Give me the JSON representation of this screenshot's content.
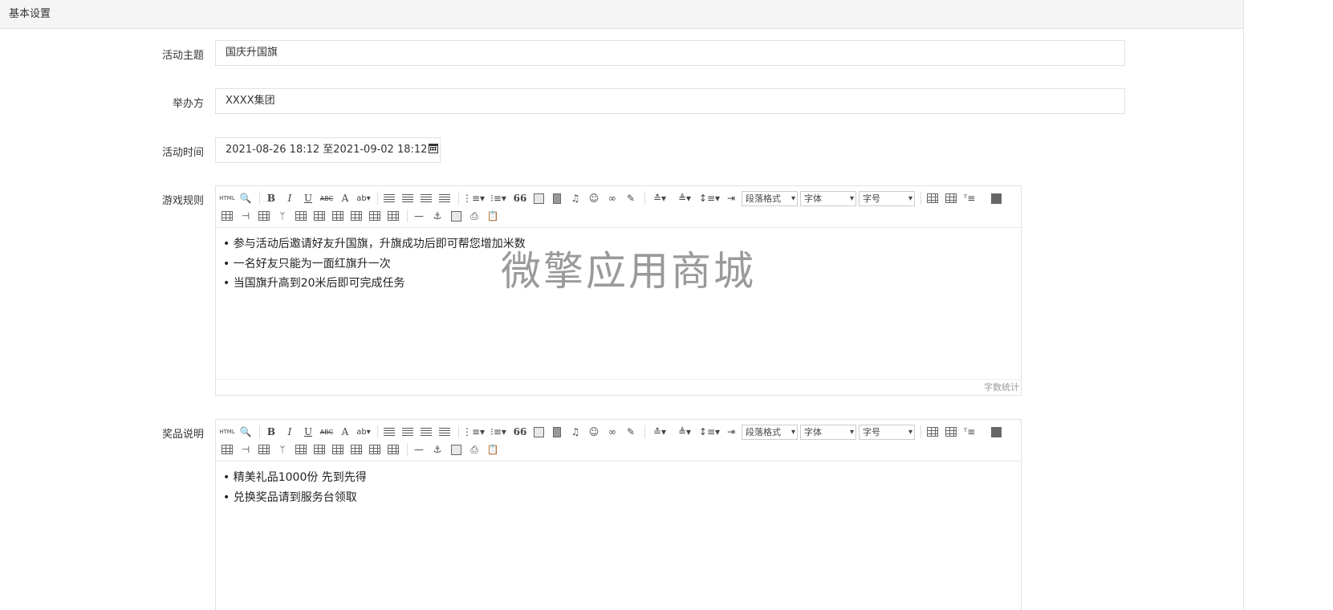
{
  "panel": {
    "title": "基本设置"
  },
  "form": {
    "theme": {
      "label": "活动主题",
      "value": "国庆升国旗"
    },
    "organizer": {
      "label": "举办方",
      "value": "XXXX集团"
    },
    "time": {
      "label": "活动时间",
      "value": "2021-08-26 18:12 至2021-09-02 18:12",
      "icon": "calendar-icon"
    },
    "rules": {
      "label": "游戏规则",
      "lines": [
        "参与活动后邀请好友升国旗，升旗成功后即可帮您增加米数",
        "一名好友只能为一面红旗升一次",
        "当国旗升高到20米后即可完成任务"
      ],
      "watermark": "微擎应用商城",
      "word_count": "字数统计"
    },
    "prizes": {
      "label": "奖品说明",
      "lines": [
        "精美礼品1000份 先到先得",
        "兑换奖品请到服务台领取"
      ]
    }
  },
  "toolbar": {
    "html_label": "HTML",
    "bold": "B",
    "italic": "I",
    "underline": "U",
    "strike": "ABC",
    "fontcolor": "A",
    "quote": "66",
    "paragraph_format": "段落格式",
    "font_family": "字体",
    "font_size": "字号"
  }
}
